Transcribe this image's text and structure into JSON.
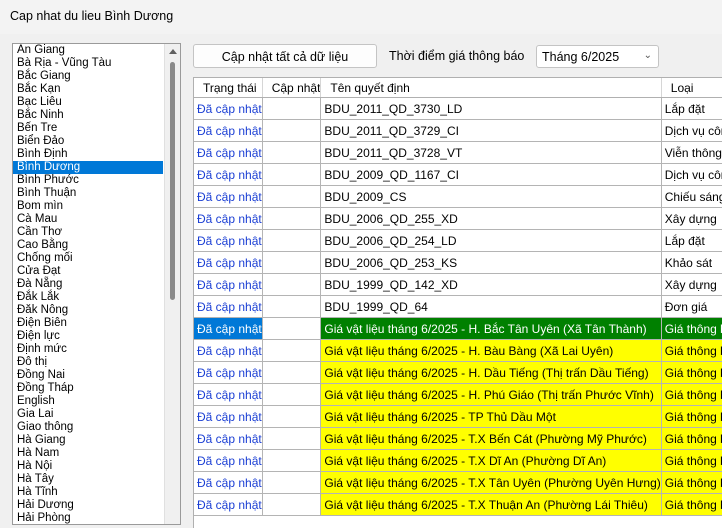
{
  "window": {
    "title": "Cap nhat du lieu Bình Dương"
  },
  "provinces": [
    "An Giang",
    "Bà Rịa - Vũng Tàu",
    "Bắc Giang",
    "Bắc Kạn",
    "Bạc Liêu",
    "Bắc Ninh",
    "Bến Tre",
    "Biển Đảo",
    "Bình Định",
    "Bình Dương",
    "Bình Phước",
    "Bình Thuận",
    "Bom mìn",
    "Cà Mau",
    "Cần Thơ",
    "Cao Bằng",
    "Chống mối",
    "Cửa Đạt",
    "Đà Nẵng",
    "Đắk Lắk",
    "Đăk Nông",
    "Điện Biên",
    "Điện lực",
    "Định mức",
    "Đô thị",
    "Đồng Nai",
    "Đồng Tháp",
    "English",
    "Gia Lai",
    "Giao thông",
    "Hà Giang",
    "Hà Nam",
    "Hà Nội",
    "Hà Tây",
    "Hà Tĩnh",
    "Hải Dương",
    "Hải Phòng"
  ],
  "selected_province": "Bình Dương",
  "toolbar": {
    "update_all_label": "Cập nhật tất cả dữ liệu",
    "time_label": "Thời điểm giá thông báo",
    "period_value": "Tháng 6/2025"
  },
  "table": {
    "columns": [
      "Trạng thái",
      "Cập nhật",
      "Tên quyết định",
      "Loại"
    ],
    "rows": [
      {
        "status": "Đã cập nhật",
        "update": "",
        "name": "BDU_2011_QD_3730_LD",
        "type": "Lắp đặt",
        "style": ""
      },
      {
        "status": "Đã cập nhật",
        "update": "",
        "name": "BDU_2011_QD_3729_CI",
        "type": "Dịch vụ công ích",
        "style": ""
      },
      {
        "status": "Đã cập nhật",
        "update": "",
        "name": "BDU_2011_QD_3728_VT",
        "type": "Viễn thông",
        "style": ""
      },
      {
        "status": "Đã cập nhật",
        "update": "",
        "name": "BDU_2009_QD_1167_CI",
        "type": "Dịch vụ công ích",
        "style": ""
      },
      {
        "status": "Đã cập nhật",
        "update": "",
        "name": "BDU_2009_CS",
        "type": "Chiếu sáng",
        "style": ""
      },
      {
        "status": "Đã cập nhật",
        "update": "",
        "name": "BDU_2006_QD_255_XD",
        "type": "Xây dựng",
        "style": ""
      },
      {
        "status": "Đã cập nhật",
        "update": "",
        "name": "BDU_2006_QD_254_LD",
        "type": "Lắp đặt",
        "style": ""
      },
      {
        "status": "Đã cập nhật",
        "update": "",
        "name": "BDU_2006_QD_253_KS",
        "type": "Khảo sát",
        "style": ""
      },
      {
        "status": "Đã cập nhật",
        "update": "",
        "name": "BDU_1999_QD_142_XD",
        "type": "Xây dựng",
        "style": ""
      },
      {
        "status": "Đã cập nhật",
        "update": "",
        "name": "BDU_1999_QD_64",
        "type": "Đơn giá",
        "style": ""
      },
      {
        "status": "Đã cập nhật",
        "update": "",
        "name": "Giá vật liệu tháng 6/2025 - H. Bắc Tân Uyên (Xã Tân Thành)",
        "type": "Giá thông báo",
        "style": "selrow"
      },
      {
        "status": "Đã cập nhật",
        "update": "",
        "name": "Giá vật liệu tháng 6/2025 - H. Bàu Bàng (Xã Lai Uyên)",
        "type": "Giá thông báo",
        "style": "yellow"
      },
      {
        "status": "Đã cập nhật",
        "update": "",
        "name": "Giá vật liệu tháng 6/2025 - H. Dầu Tiếng (Thị trấn Dầu Tiếng)",
        "type": "Giá thông báo",
        "style": "yellow"
      },
      {
        "status": "Đã cập nhật",
        "update": "",
        "name": "Giá vật liệu tháng 6/2025 - H. Phú Giáo (Thị trấn Phước Vĩnh)",
        "type": "Giá thông báo",
        "style": "yellow"
      },
      {
        "status": "Đã cập nhật",
        "update": "",
        "name": "Giá vật liệu tháng 6/2025 - TP Thủ Dầu Một",
        "type": "Giá thông báo",
        "style": "yellow"
      },
      {
        "status": "Đã cập nhật",
        "update": "",
        "name": "Giá vật liệu tháng 6/2025 - T.X Bến Cát (Phường Mỹ Phước)",
        "type": "Giá thông báo",
        "style": "yellow"
      },
      {
        "status": "Đã cập nhật",
        "update": "",
        "name": "Giá vật liệu tháng 6/2025 - T.X Dĩ An (Phường Dĩ An)",
        "type": "Giá thông báo",
        "style": "yellow"
      },
      {
        "status": "Đã cập nhật",
        "update": "",
        "name": "Giá vật liệu tháng 6/2025 - T.X Tân Uyên (Phường Uyên Hưng)",
        "type": "Giá thông báo",
        "style": "yellow"
      },
      {
        "status": "Đã cập nhật",
        "update": "",
        "name": "Giá vật liệu tháng 6/2025 - T.X Thuận An (Phường Lái Thiêu)",
        "type": "Giá thông báo",
        "style": "yellow"
      }
    ]
  }
}
